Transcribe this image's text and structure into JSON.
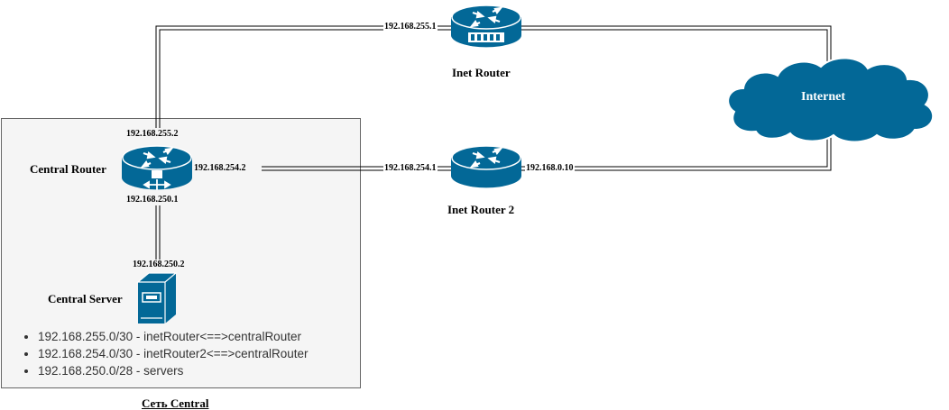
{
  "diagram": {
    "group": {
      "caption": "Сеть Central"
    },
    "nodes": {
      "inet_router": {
        "title": "Inet Router",
        "ip": "192.168.255.1"
      },
      "inet_router_2": {
        "title": "Inet Router 2",
        "ip_left": "192.168.254.1",
        "ip_right": "192.168.0.10"
      },
      "central_router": {
        "title": "Central Router",
        "ip_top": "192.168.255.2",
        "ip_right": "192.168.254.2",
        "ip_bottom": "192.168.250.1"
      },
      "central_server": {
        "title": "Central Server",
        "ip": "192.168.250.2"
      },
      "internet": {
        "title": "Internet"
      }
    },
    "subnets": [
      "192.168.255.0/30 - inetRouter<==>centralRouter",
      "192.168.254.0/30 - inetRouter2<==>centralRouter",
      "192.168.250.0/28 - servers"
    ],
    "colors": {
      "device": "#036897",
      "device_stroke": "#ffffff",
      "group_fill": "#f5f5f5",
      "group_border": "#666666",
      "link": "#000000"
    }
  }
}
